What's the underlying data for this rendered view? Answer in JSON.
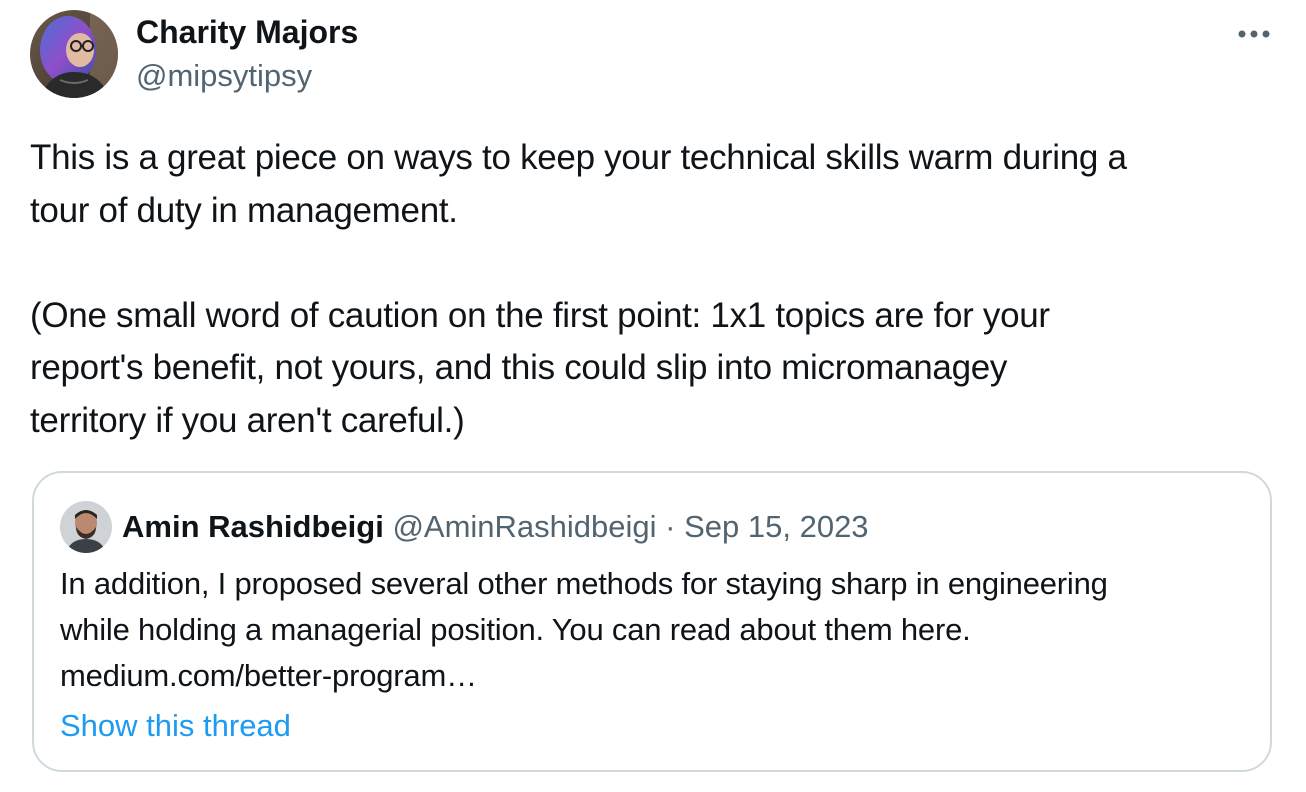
{
  "tweet": {
    "author": {
      "name": "Charity Majors",
      "handle": "@mipsytipsy"
    },
    "text": "This is a great piece on ways to keep your technical skills warm during a\ntour of duty in management.\n\n(One small word of caution on the first point: 1x1 topics are for your\nreport's benefit, not yours, and this could slip into micromanagey\nterritory if you aren't careful.)",
    "more_icon": "more-horizontal-icon"
  },
  "quote": {
    "author": {
      "name": "Amin Rashidbeigi",
      "handle": "@AminRashidbeigi"
    },
    "separator": "·",
    "date": "Sep 15, 2023",
    "text": "In addition, I proposed several other methods for staying sharp in engineering\nwhile holding a managerial position. You can read about them here.\nmedium.com/better-program…",
    "show_thread": "Show this thread"
  },
  "colors": {
    "text": "#0f1419",
    "secondary": "#536471",
    "link": "#1d9bf0",
    "border": "#cfd9de"
  }
}
